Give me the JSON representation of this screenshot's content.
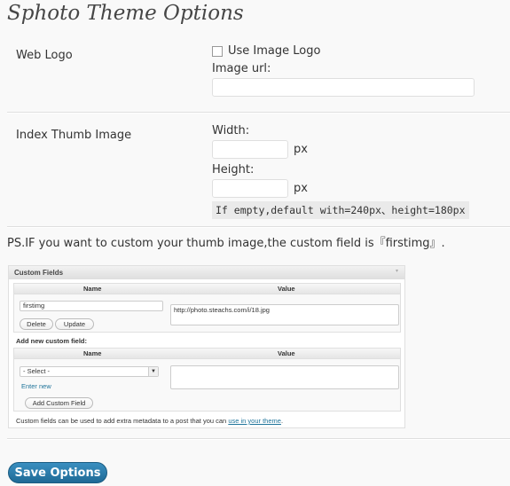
{
  "page": {
    "title": "Sphoto Theme Options"
  },
  "web_logo": {
    "label": "Web Logo",
    "checkbox_label": "Use Image Logo",
    "url_label": "Image url:",
    "url_value": ""
  },
  "thumb": {
    "label": "Index Thumb Image",
    "width_label": "Width:",
    "width_value": "",
    "width_unit": "px",
    "height_label": "Height:",
    "height_value": "",
    "height_unit": "px",
    "note": "If empty,default with=240px、height=180px"
  },
  "ps_text": "PS.IF you want to custom your thumb image,the custom field is『firstimg』.",
  "custom_fields": {
    "panel_title": "Custom Fields",
    "name_header": "Name",
    "value_header": "Value",
    "field_name": "firstimg",
    "field_value": "http://photo.steachs.com/i/18.jpg",
    "delete_label": "Delete",
    "update_label": "Update",
    "add_new_label": "Add new custom field:",
    "select_value": "- Select -",
    "enter_new": "Enter new",
    "add_button": "Add Custom Field",
    "footer_text": "Custom fields can be used to add extra metadata to a post that you can",
    "footer_link": "use in your theme",
    "footer_end": "."
  },
  "save_button": "Save Options"
}
